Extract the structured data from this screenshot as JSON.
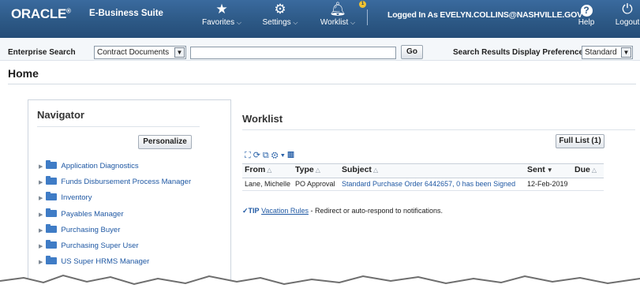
{
  "header": {
    "logo": "ORACLE",
    "logo_mark": "®",
    "suite": "E-Business Suite",
    "favorites": "Favorites",
    "settings": "Settings",
    "worklist": "Worklist",
    "worklist_badge": "1",
    "logged_in": "Logged In As EVELYN.COLLINS@NASHVILLE.GOV",
    "help": "Help",
    "logout": "Logout"
  },
  "search": {
    "label": "Enterprise Search",
    "category_value": "Contract Documents",
    "input_value": "",
    "go": "Go",
    "pref_label": "Search Results Display Preference",
    "pref_value": "Standard"
  },
  "page_title": "Home",
  "navigator": {
    "title": "Navigator",
    "personalize": "Personalize",
    "items": [
      {
        "label": "Application Diagnostics"
      },
      {
        "label": "Funds Disbursement Process Manager"
      },
      {
        "label": "Inventory"
      },
      {
        "label": "Payables Manager"
      },
      {
        "label": "Purchasing Buyer"
      },
      {
        "label": "Purchasing Super User"
      },
      {
        "label": "US Super HRMS Manager"
      }
    ]
  },
  "worklist": {
    "title": "Worklist",
    "full_list": "Full List (1)",
    "columns": {
      "from": "From",
      "type": "Type",
      "subject": "Subject",
      "sent": "Sent",
      "due": "Due"
    },
    "rows": [
      {
        "from": "Lane, Michelle",
        "type": "PO Approval",
        "subject": "Standard Purchase Order 6442657, 0 has been Signed",
        "sent": "12-Feb-2019",
        "due": ""
      }
    ],
    "tip_label": "TIP",
    "tip_link": "Vacation Rules",
    "tip_text": " - Redirect or auto-respond to notifications."
  },
  "colors": {
    "header": "#2d5986",
    "link": "#1f58a3"
  }
}
